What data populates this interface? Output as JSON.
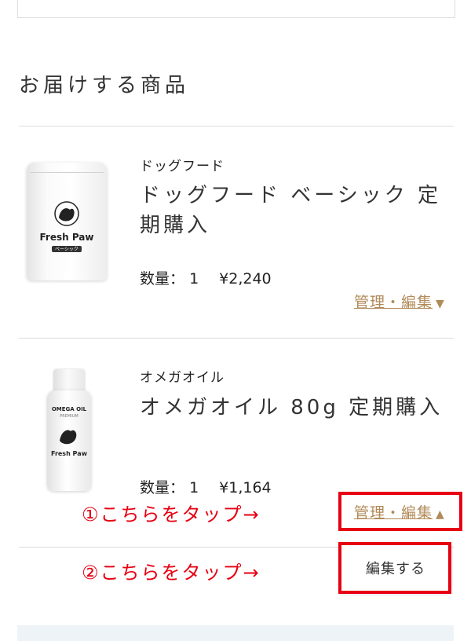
{
  "section": {
    "title": "お届けする商品"
  },
  "products": [
    {
      "category": "ドッグフード",
      "name": "ドッグフード ベーシック 定期購入",
      "qty_label": "数量：",
      "qty": "1",
      "price": "¥2,240",
      "manage_label": "管理・編集",
      "chevron": "chevron-down-icon",
      "package": {
        "brand": "Fresh Paw",
        "tag": "ベーシック"
      }
    },
    {
      "category": "オメガオイル",
      "name": "オメガオイル 80g 定期購入",
      "qty_label": "数量：",
      "qty": "1",
      "price": "¥1,164",
      "manage_label": "管理・編集",
      "chevron": "chevron-up-icon",
      "package": {
        "product": "OMEGA OIL",
        "grade": "PREMIUM",
        "brand": "Fresh Paw"
      }
    }
  ],
  "dropdown": {
    "edit_label": "編集する"
  },
  "annotations": {
    "step1": "①こちらをタップ→",
    "step2": "②こちらをタップ→"
  },
  "colors": {
    "link": "#b08a58",
    "annotation": "#e60012",
    "divider": "#dcdcdc"
  }
}
